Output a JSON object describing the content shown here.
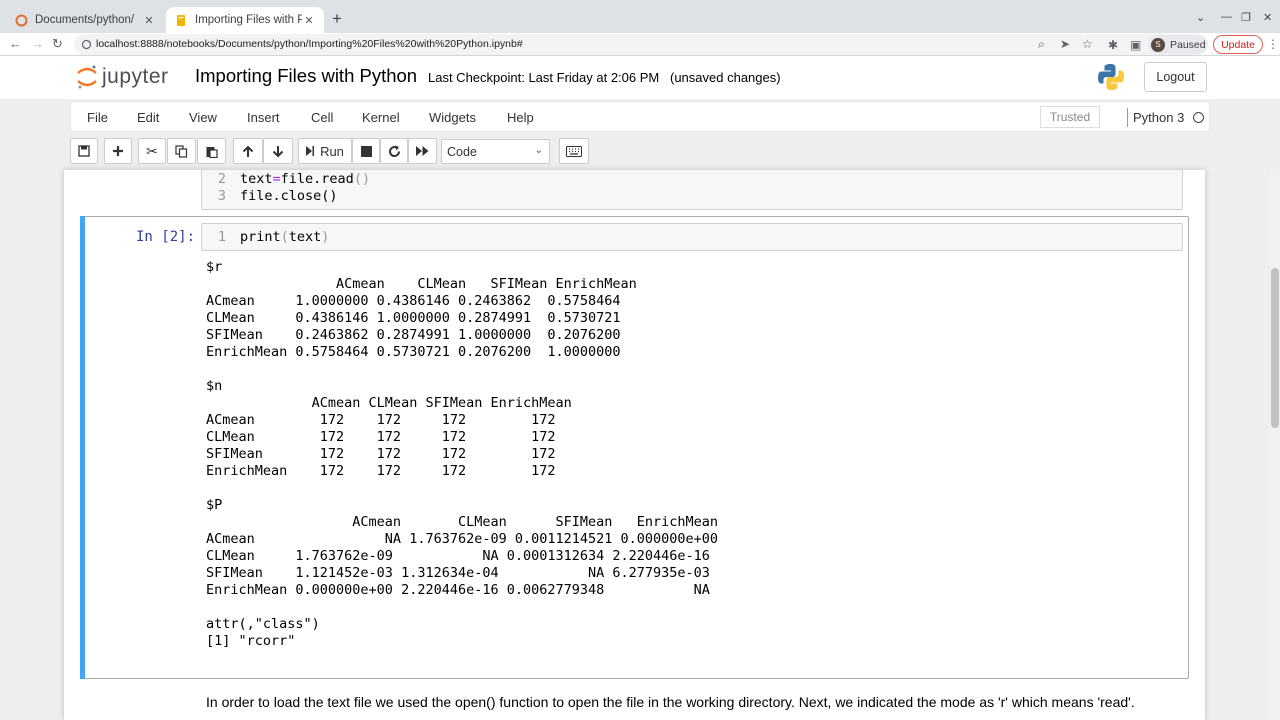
{
  "browser": {
    "tabs": [
      {
        "title": "Documents/python/",
        "close": "✕"
      },
      {
        "title": "Importing Files with Pytho",
        "close": "✕"
      }
    ],
    "new_tab": "+",
    "url": "localhost:8888/notebooks/Documents/python/Importing%20Files%20with%20Python.ipynb#",
    "profile_initial": "S",
    "profile_status": "Paused",
    "update_label": "Update"
  },
  "header": {
    "logo_text": "jupyter",
    "notebook_title": "Importing Files with Python",
    "checkpoint": "Last Checkpoint: Last Friday at 2:06 PM",
    "unsaved": "(unsaved changes)",
    "logout": "Logout"
  },
  "menubar": {
    "items": [
      "File",
      "Edit",
      "View",
      "Insert",
      "Cell",
      "Kernel",
      "Widgets",
      "Help"
    ],
    "trusted": "Trusted",
    "kernel": "Python 3"
  },
  "toolbar": {
    "run_label": "Run",
    "cell_type": "Code"
  },
  "notebook": {
    "prev_cell": {
      "lines": [
        {
          "n": "2",
          "code": "text=file.read()"
        },
        {
          "n": "3",
          "code": "file.close()"
        }
      ]
    },
    "active_cell": {
      "prompt": "In [2]:",
      "line_no": "1",
      "code": "print(text)",
      "output": "$r\n                ACmean    CLMean   SFIMean EnrichMean\nACmean     1.0000000 0.4386146 0.2463862  0.5758464\nCLMean     0.4386146 1.0000000 0.2874991  0.5730721\nSFIMean    0.2463862 0.2874991 1.0000000  0.2076200\nEnrichMean 0.5758464 0.5730721 0.2076200  1.0000000\n\n$n\n             ACmean CLMean SFIMean EnrichMean\nACmean        172    172     172        172\nCLMean        172    172     172        172\nSFIMean       172    172     172        172\nEnrichMean    172    172     172        172\n\n$P\n                  ACmean       CLMean      SFIMean   EnrichMean\nACmean                NA 1.763762e-09 0.0011214521 0.000000e+00\nCLMean     1.763762e-09           NA 0.0001312634 2.220446e-16\nSFIMean    1.121452e-03 1.312634e-04           NA 6.277935e-03\nEnrichMean 0.000000e+00 2.220446e-16 0.0062779348           NA\n\nattr(,\"class\")\n[1] \"rcorr\""
    },
    "markdown_text": "In order to load the text file we used the open() function to open the file in the working directory. Next, we indicated the mode as 'r' which means 'read'."
  }
}
